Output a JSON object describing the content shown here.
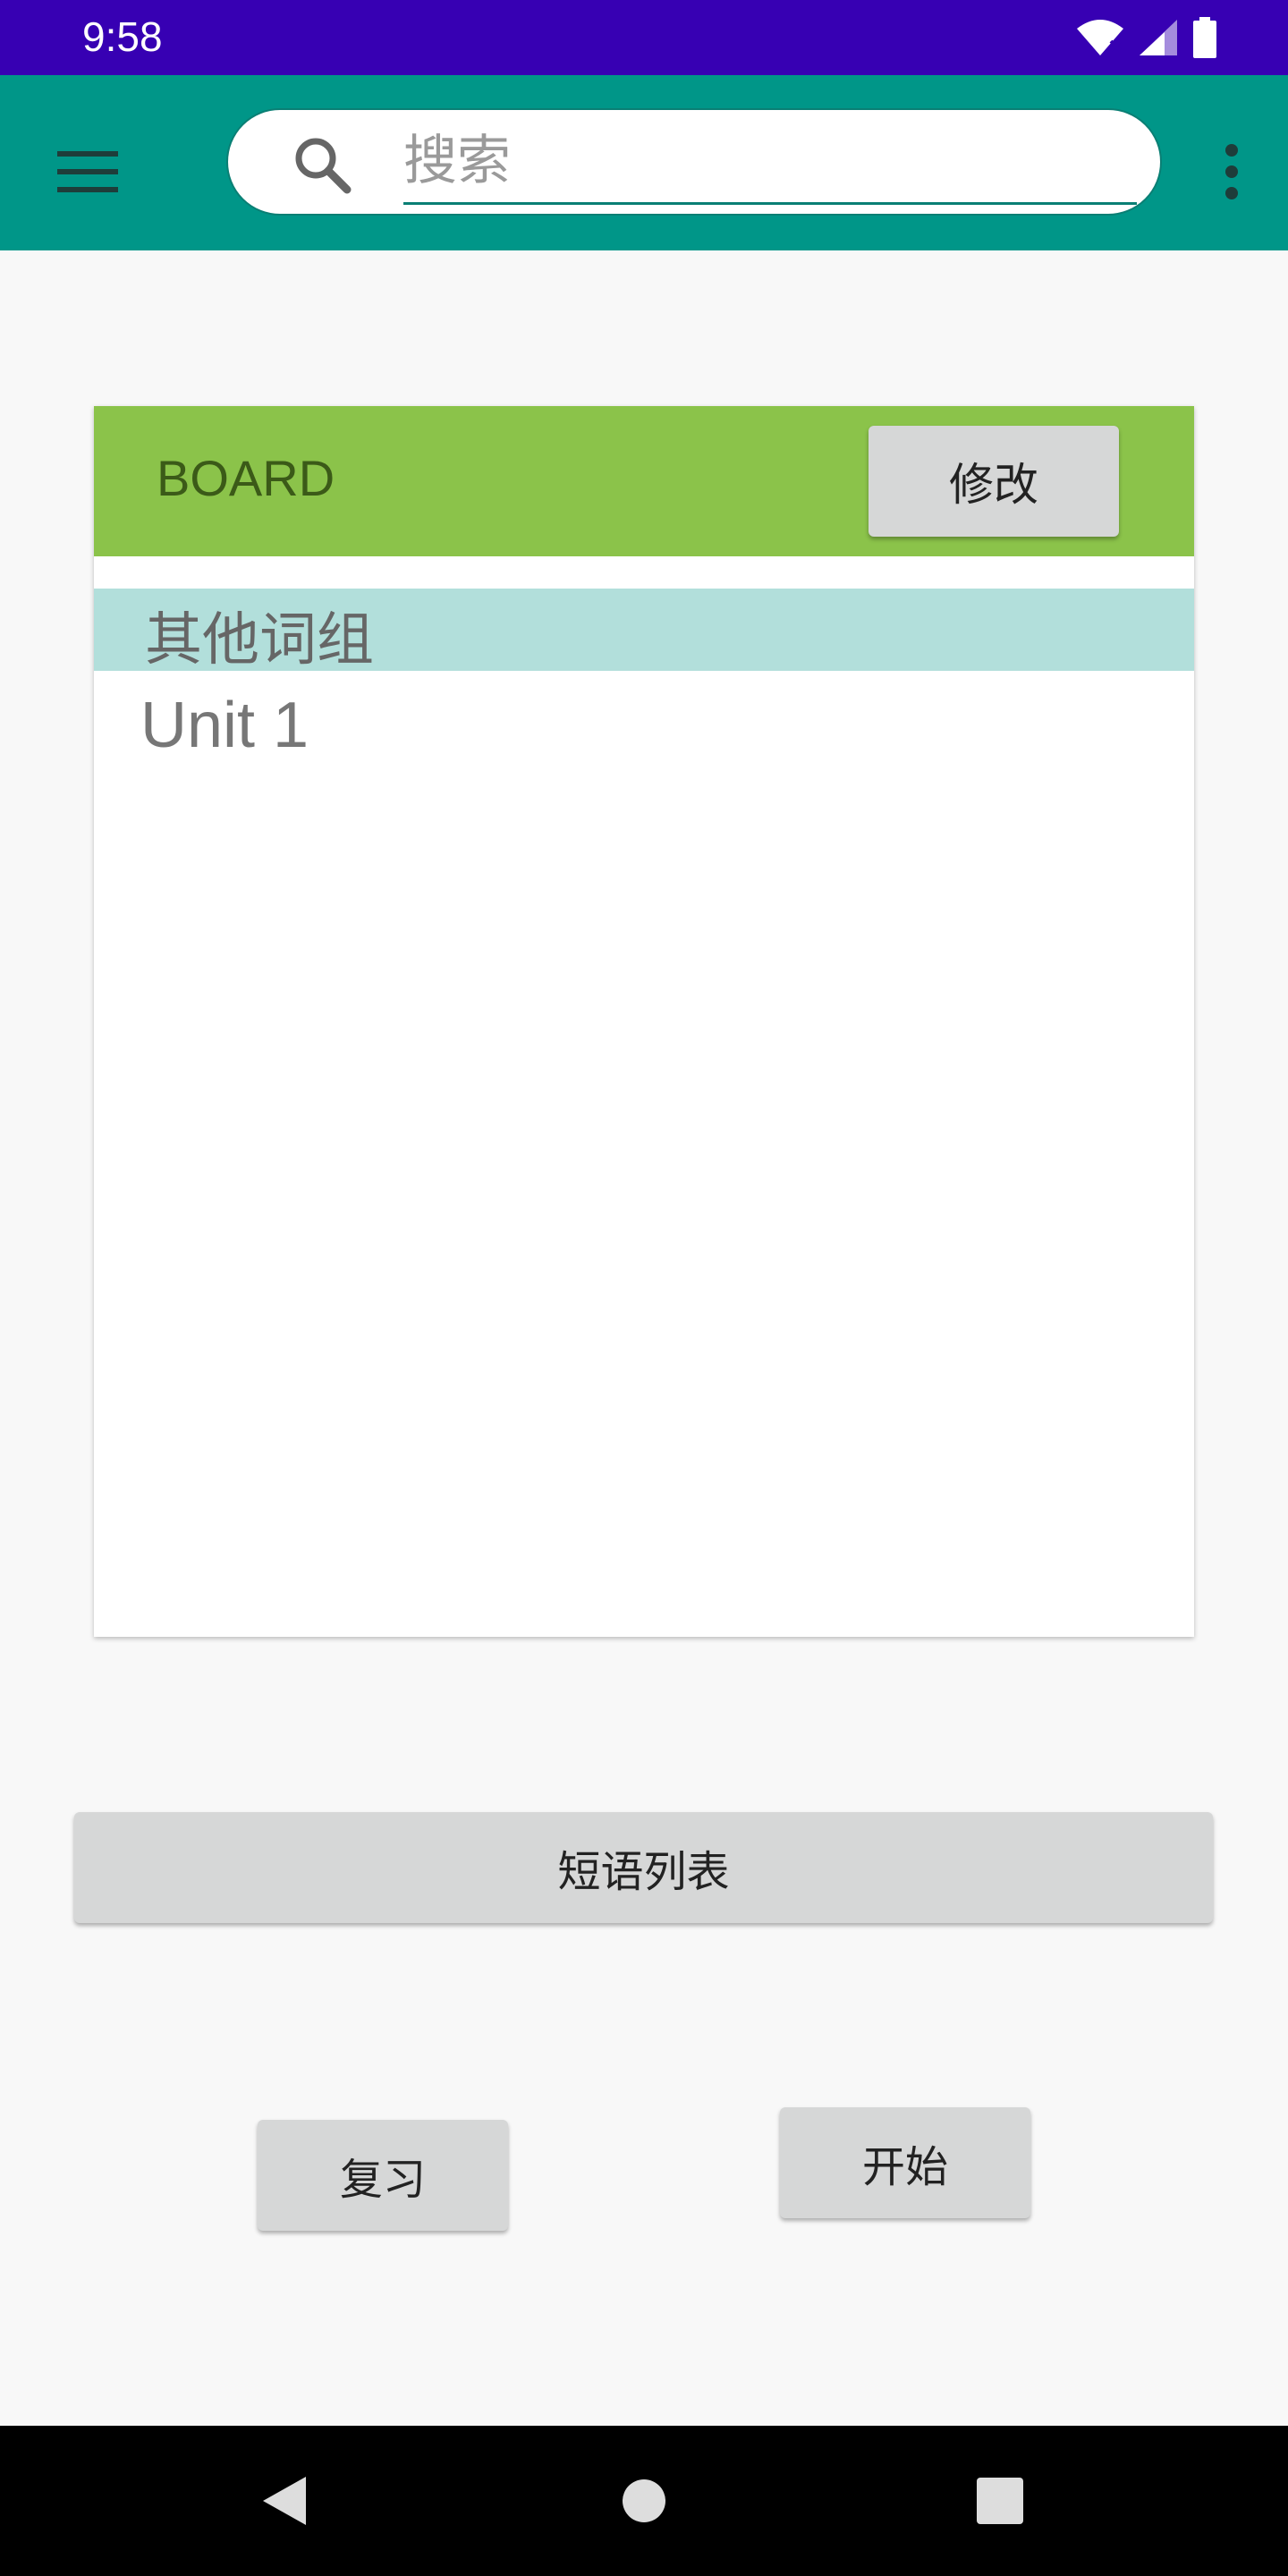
{
  "status_bar": {
    "time": "9:58",
    "icons": [
      "wifi-icon",
      "signal-icon",
      "battery-icon"
    ]
  },
  "app_bar": {
    "menu_icon": "hamburger-menu-icon",
    "search": {
      "placeholder": "搜索",
      "value": "",
      "icon": "search-icon"
    },
    "more_icon": "more-vert-icon"
  },
  "board": {
    "title": "BOARD",
    "edit_label": "修改",
    "group_header": "其他词组",
    "items": [
      {
        "label": "Unit 1"
      }
    ]
  },
  "actions": {
    "phrase_list_label": "短语列表",
    "review_label": "复习",
    "start_label": "开始"
  },
  "nav_bar": {
    "icons": [
      "back-icon",
      "home-icon",
      "recents-icon"
    ]
  },
  "colors": {
    "status_bar": "#3700b3",
    "app_bar": "#009688",
    "board_header": "#8bc34a",
    "group_header": "#b2dfdb",
    "button": "#d6d7d7"
  }
}
